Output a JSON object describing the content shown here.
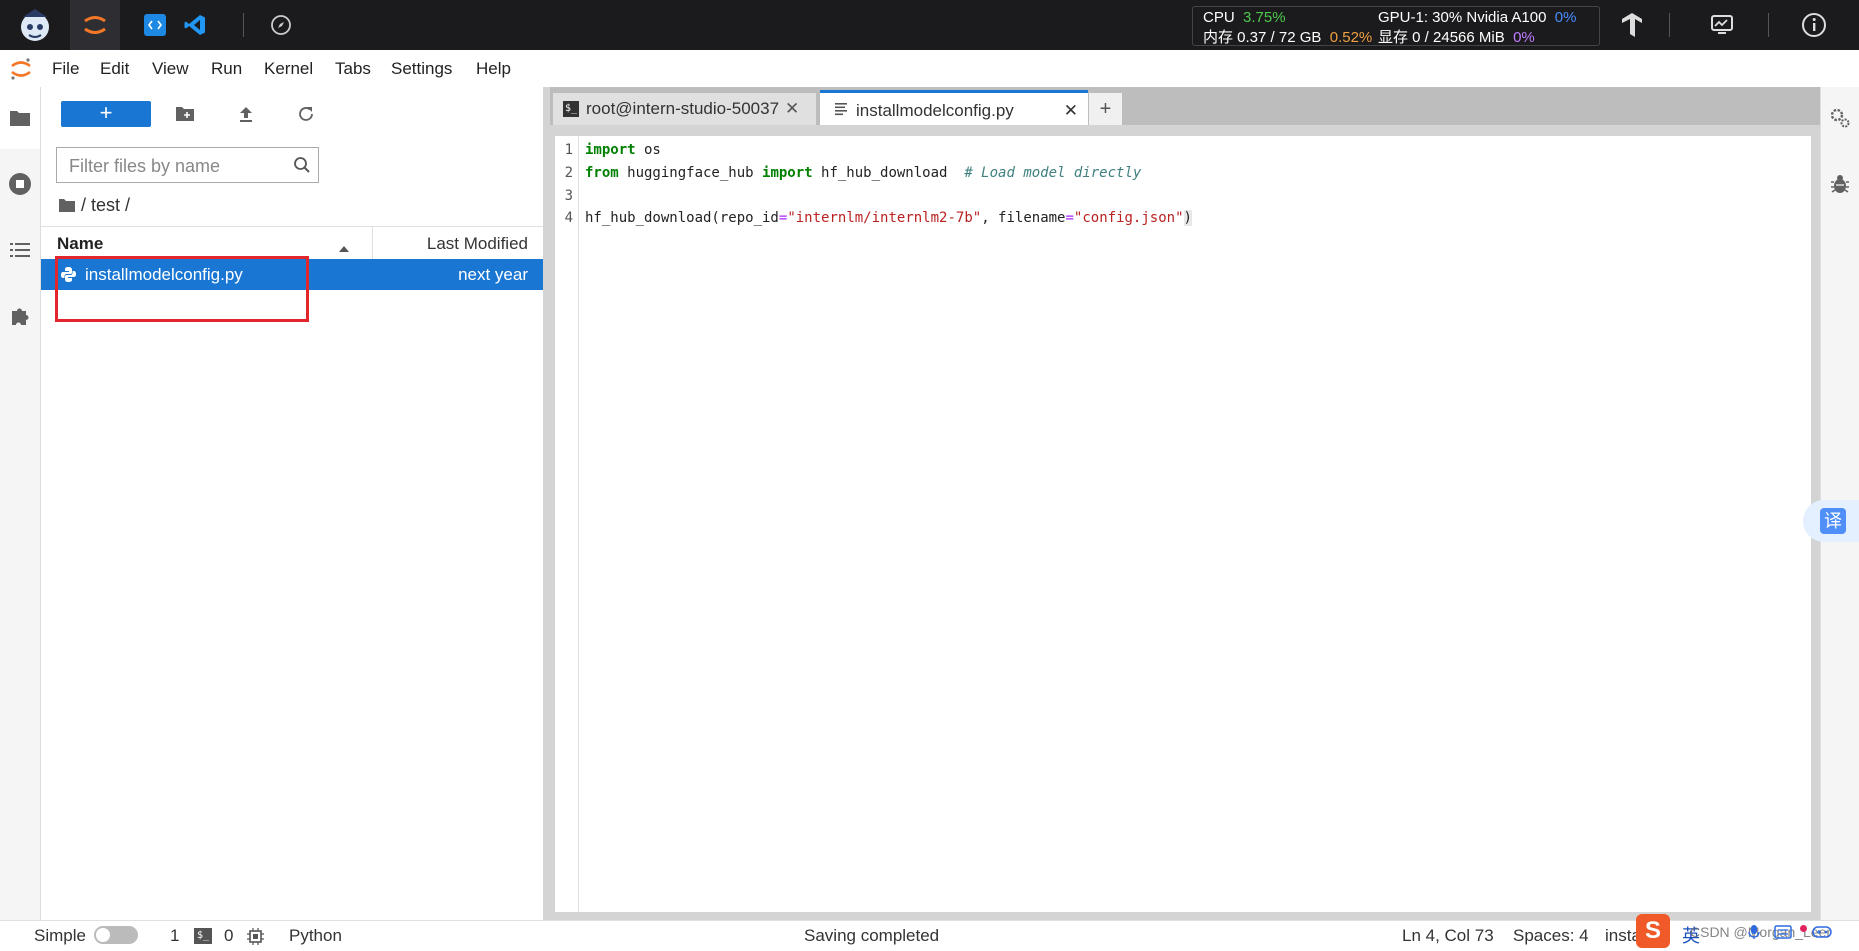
{
  "topbar": {
    "stats": {
      "cpu_label": "CPU",
      "cpu_value": "3.75%",
      "gpu_label": "GPU-1: 30% Nvidia A100",
      "gpu_value": "0%",
      "mem_label": "内存 0.37 / 72 GB",
      "mem_value": "0.52%",
      "vram_label": "显存 0 / 24566 MiB",
      "vram_value": "0%"
    }
  },
  "menu": [
    "File",
    "Edit",
    "View",
    "Run",
    "Kernel",
    "Tabs",
    "Settings",
    "Help"
  ],
  "filebrowser": {
    "new_label": "+",
    "filter_placeholder": "Filter files by name",
    "breadcrumb": "/ test /",
    "col_name": "Name",
    "col_modified": "Last Modified",
    "files": [
      {
        "name": "installmodelconfig.py",
        "modified": "next year"
      }
    ]
  },
  "tabs": [
    {
      "label": "root@intern-studio-50037"
    },
    {
      "label": "installmodelconfig.py"
    }
  ],
  "tab_add": "+",
  "editor": {
    "line_numbers": [
      "1",
      "2",
      "3",
      "4"
    ],
    "line1": {
      "kw": "import",
      "rest": " os"
    },
    "line2": {
      "kw1": "from",
      "mod": " huggingface_hub ",
      "kw2": "import",
      "name": " hf_hub_download  ",
      "comment": "# Load model directly"
    },
    "line4": {
      "fn": "hf_hub_download(repo_id",
      "eq1": "=",
      "s1": "\"internlm/internlm2-7b\"",
      "mid": ", filename",
      "eq2": "=",
      "s2": "\"config.json\"",
      "end": ")"
    }
  },
  "statusbar": {
    "mode": "Simple",
    "terminals": "1",
    "kernels": "0",
    "kernel_name": "Python",
    "message": "Saving completed",
    "cursor": "Ln 4, Col 73",
    "spaces": "Spaces: 4",
    "file_short": "insta"
  },
  "translate_label": "译",
  "ime": {
    "lang": "英",
    "watermark": "CSDN @Morgan_Leer"
  },
  "colors": {
    "accent": "#1976d2",
    "jupyter_orange": "#f37726",
    "highlight_red": "#e2262b"
  }
}
